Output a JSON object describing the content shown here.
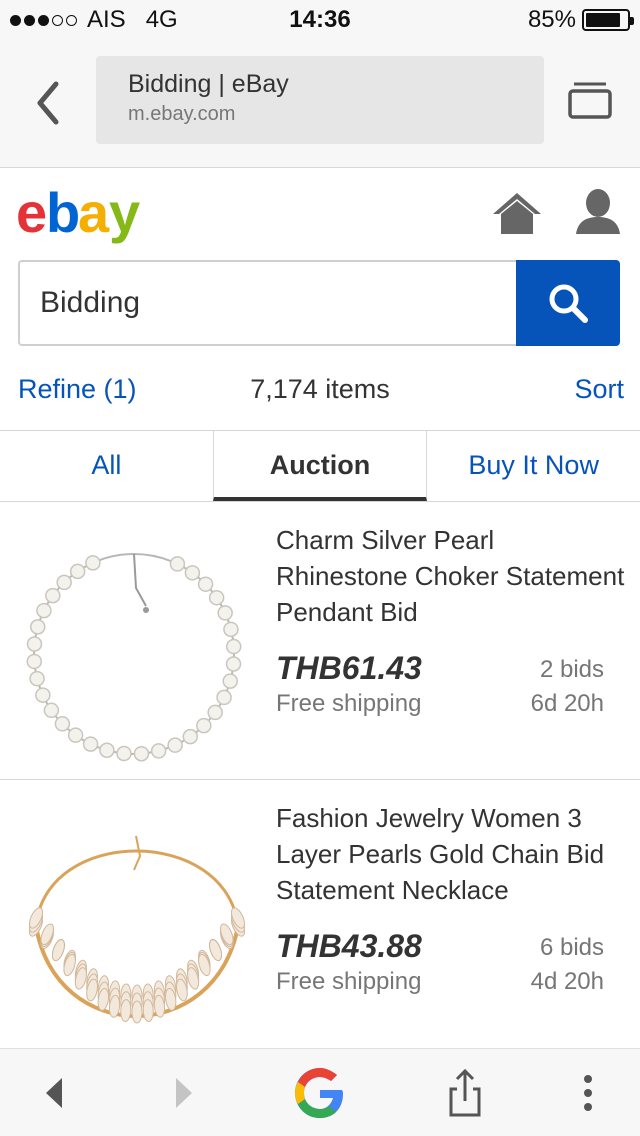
{
  "status_bar": {
    "carrier": "AIS",
    "network": "4G",
    "time": "14:36",
    "battery": "85%",
    "battery_level": 0.85,
    "signal_bars": 3
  },
  "browser": {
    "page_title": "Bidding | eBay",
    "host": "m.ebay.com"
  },
  "header": {
    "logo_icon": "ebay-logo",
    "home_icon": "home-icon",
    "user_icon": "user-icon"
  },
  "search": {
    "value": "Bidding",
    "button_icon": "search-icon"
  },
  "results": {
    "refine_label": "Refine (1)",
    "count_label": "7,174 items",
    "sort_label": "Sort"
  },
  "tabs": [
    {
      "label": "All",
      "active": false
    },
    {
      "label": "Auction",
      "active": true
    },
    {
      "label": "Buy It Now",
      "active": false
    }
  ],
  "listings": [
    {
      "title": "Charm Silver Pearl Rhinestone Choker Statement Pendant Bid",
      "price": "THB61.43",
      "bids": "2 bids",
      "shipping": "Free shipping",
      "time_left": "6d 20h"
    },
    {
      "title": "Fashion Jewelry Women 3 Layer Pearls Gold Chain Bid Statement Necklace",
      "price": "THB43.88",
      "bids": "6 bids",
      "shipping": "Free shipping",
      "time_left": "4d 20h"
    }
  ],
  "colors": {
    "link_blue": "#0654ba",
    "ebay_red": "#e53238",
    "ebay_blue": "#0064d2",
    "ebay_yellow": "#f5af02",
    "ebay_green": "#86b817"
  }
}
